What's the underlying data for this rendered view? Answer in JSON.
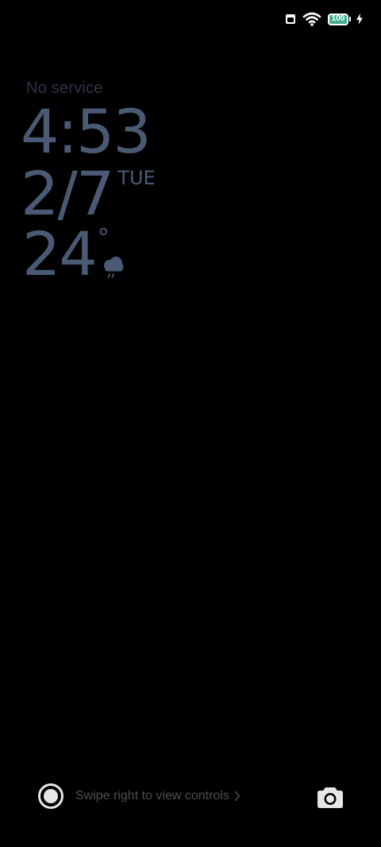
{
  "status_bar": {
    "icons": [
      "sim-icon",
      "wifi-icon",
      "battery-icon",
      "charging-bolt-icon"
    ],
    "battery_level": "100",
    "battery_color": "#3fae8f"
  },
  "lockscreen": {
    "carrier": "No service",
    "time": "4:53",
    "date": "2/7",
    "weekday": "TUE",
    "temperature": "24",
    "degree_symbol": "°",
    "weather_icon": "rain-cloud-icon",
    "text_color": "#4a5a74"
  },
  "bottom_bar": {
    "left_button_icon": "controls-ring-icon",
    "swipe_hint": "Swipe right to view controls",
    "chevron_icon": "chevron-right-icon",
    "camera_icon": "camera-icon"
  }
}
